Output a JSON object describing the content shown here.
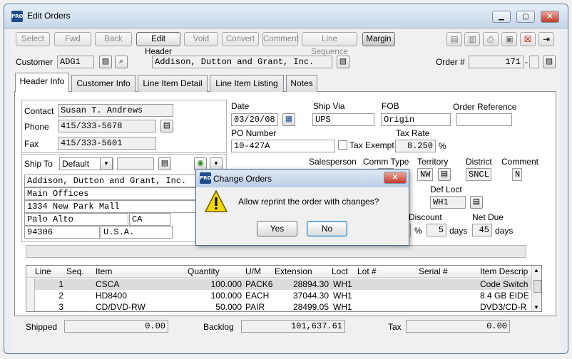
{
  "window": {
    "title": "Edit Orders",
    "app_icon": "PRO"
  },
  "toolbar": {
    "buttons": [
      "Select",
      "Fwd",
      "Back",
      "Edit Header",
      "Void",
      "Convert",
      "Comment",
      "Line Sequence",
      "Margin"
    ]
  },
  "customer": {
    "label": "Customer",
    "code": "ADG1",
    "name": "Addison, Dutton and Grant, Inc.",
    "order_label": "Order #",
    "order_no": "171",
    "order_suffix": ""
  },
  "tabs": [
    "Header Info",
    "Customer Info",
    "Line Item Detail",
    "Line Item Listing",
    "Notes"
  ],
  "contact": {
    "contact_label": "Contact",
    "contact": "Susan T. Andrews",
    "phone_label": "Phone",
    "phone": "415/333-5678",
    "fax_label": "Fax",
    "fax": "415/333-5601"
  },
  "shipto": {
    "label": "Ship To",
    "selected": "Default",
    "addr1": "Addison, Dutton and Grant, Inc.",
    "addr2": "Main Offices",
    "addr3": "1334 New Park Mall",
    "city": "Palo Alto",
    "state": "CA",
    "zip": "94306",
    "country": "U.S.A."
  },
  "order": {
    "date_label": "Date",
    "date": "03/20/08",
    "shipvia_label": "Ship Via",
    "shipvia": "UPS",
    "fob_label": "FOB",
    "fob": "Origin",
    "ref_label": "Order Reference",
    "ref": "",
    "po_label": "PO Number",
    "po": "10-427A",
    "tax_exempt_label": "Tax Exempt",
    "taxrate_label": "Tax Rate",
    "taxrate": "8.250",
    "pct": "%",
    "salesperson_label": "Salesperson",
    "commtype_label": "Comm Type",
    "territory_label": "Territory",
    "territory": "NW",
    "district_label": "District",
    "district": "SNCL",
    "comment_label": "Comment",
    "comment": "N",
    "defloc_label": "Def Loct",
    "defloc": "WH1",
    "discount_label": "Discount",
    "discount_days": "5",
    "days1": "days",
    "netdue_label": "Net Due",
    "netdue": "45",
    "days2": "days"
  },
  "grid": {
    "headers": [
      "Line",
      "Seq.",
      "Item",
      "Quantity",
      "U/M",
      "Extension",
      "Loct",
      "Lot #",
      "Serial #",
      "Item Descrip"
    ],
    "rows": [
      {
        "line": "1",
        "seq": "",
        "item": "CSCA",
        "qty": "100.000",
        "um": "PACK6",
        "ext": "28894.30",
        "loc": "WH1",
        "lot": "",
        "serial": "",
        "desc": "Code Switch"
      },
      {
        "line": "2",
        "seq": "",
        "item": "HD8400",
        "qty": "100.000",
        "um": "EACH",
        "ext": "37044.30",
        "loc": "WH1",
        "lot": "",
        "serial": "",
        "desc": "8.4 GB EIDE"
      },
      {
        "line": "3",
        "seq": "",
        "item": "CD/DVD-RW",
        "qty": "50.000",
        "um": "PAIR",
        "ext": "28499.05",
        "loc": "WH1",
        "lot": "",
        "serial": "",
        "desc": "DVD3/CD-R"
      }
    ]
  },
  "totals": {
    "shipped_label": "Shipped",
    "shipped": "0.00",
    "backlog_label": "Backlog",
    "backlog": "101,637.61",
    "tax_label": "Tax",
    "tax": "0.00"
  },
  "dialog": {
    "title": "Change Orders",
    "message": "Allow reprint the order with changes?",
    "yes": "Yes",
    "no": "No"
  }
}
